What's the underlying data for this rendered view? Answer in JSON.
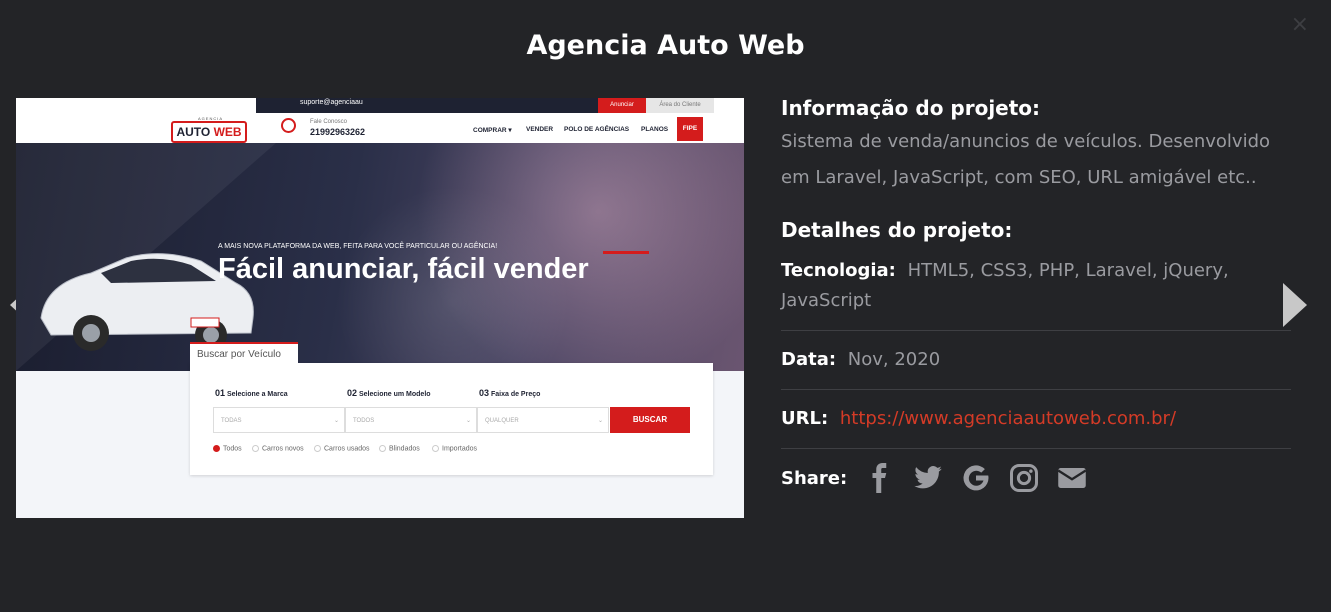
{
  "modal": {
    "title": "Agencia Auto Web",
    "close": "×"
  },
  "screenshot": {
    "email": "suporte@agenciaau",
    "anunciar": "Anunciar",
    "area_cliente": "Área do Cliente",
    "logo_top": "AGENCIA",
    "logo_auto": "AUTO",
    "logo_web": "WEB",
    "fale_conosco": "Fale Conosco",
    "phone": "21992963262",
    "menu": [
      "COMPRAR ▾",
      "VENDER",
      "POLO DE AGÊNCIAS",
      "PLANOS"
    ],
    "fipe": "FIPE",
    "tagline": "A MAIS NOVA PLATAFORMA DA WEB, FEITA PARA VOCÊ PARTICULAR OU AGÊNCIA!",
    "headline": "Fácil anunciar, fácil vender",
    "search_tab": "Buscar por Veículo",
    "steps": [
      {
        "num": "01",
        "label": "Selecione a Marca"
      },
      {
        "num": "02",
        "label": "Selecione um Modelo"
      },
      {
        "num": "03",
        "label": "Faixa de Preço"
      }
    ],
    "selects": [
      "TODAS",
      "TODOS",
      "QUALQUER"
    ],
    "search_button": "BUSCAR",
    "radios": [
      "Todos",
      "Carros novos",
      "Carros usados",
      "Blindados",
      "Importados"
    ]
  },
  "info": {
    "heading": "Informação do projeto:",
    "description": "Sistema de venda/anuncios de veículos. Desenvolvido em Laravel, JavaScript, com SEO, URL amigável etc..",
    "details_heading": "Detalhes do projeto:",
    "tech_label": "Tecnologia:",
    "tech_value": "HTML5, CSS3, PHP, Laravel, jQuery, JavaScript",
    "date_label": "Data:",
    "date_value": "Nov, 2020",
    "url_label": "URL:",
    "url_value": "https://www.agenciaautoweb.com.br/",
    "share_label": "Share:",
    "share_icons": [
      "facebook-icon",
      "twitter-icon",
      "google-icon",
      "instagram-icon",
      "email-icon"
    ]
  },
  "colors": {
    "background": "#232427",
    "accent_red": "#d43b27",
    "muted_text": "#9a9ba0"
  }
}
